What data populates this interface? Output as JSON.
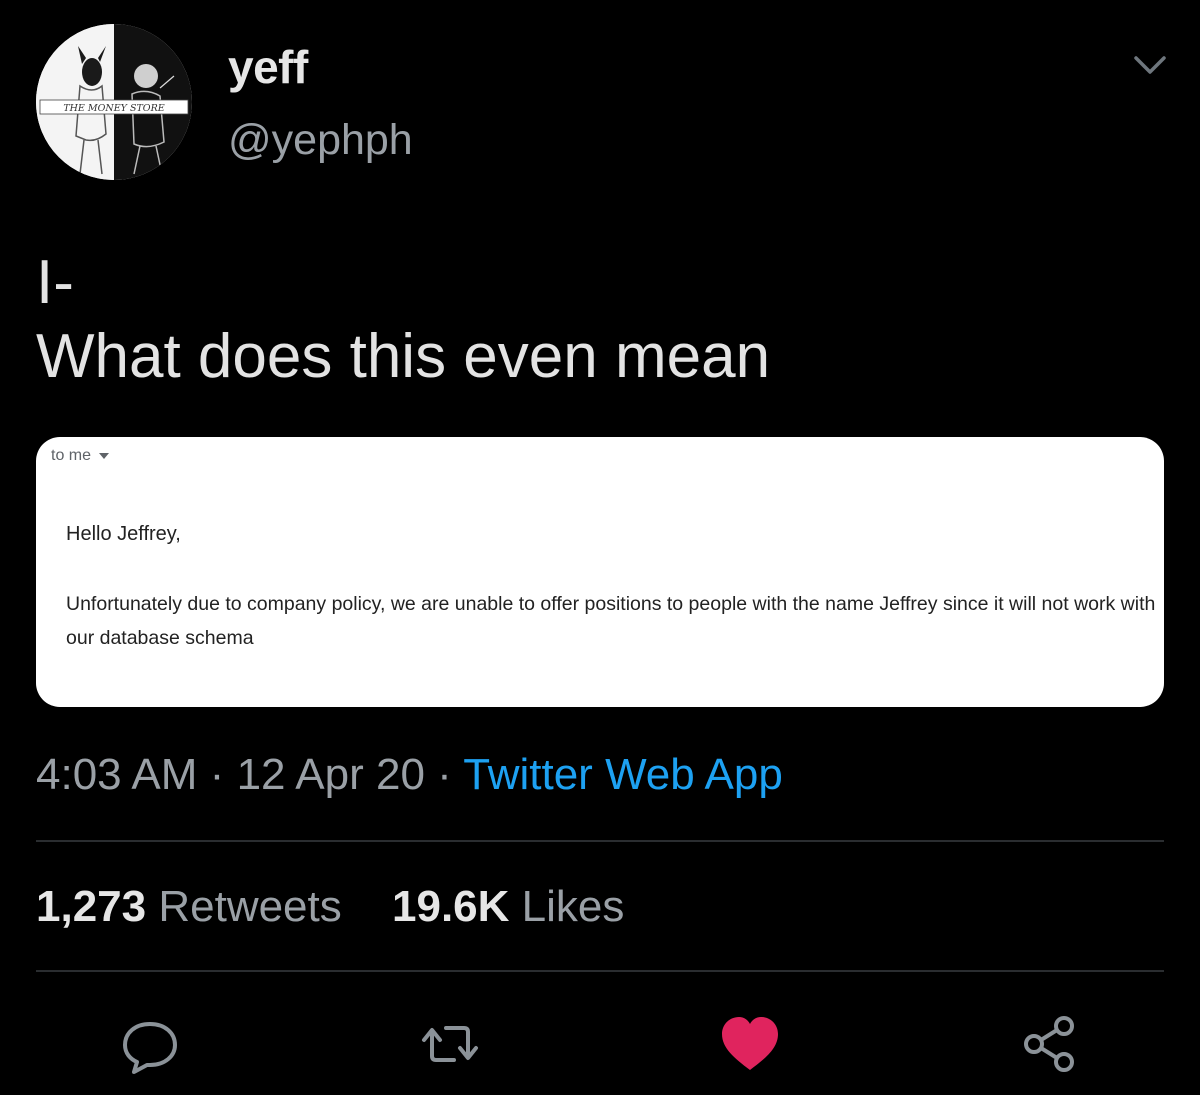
{
  "tweet": {
    "user": {
      "display_name": "yeff",
      "handle": "@yephph",
      "avatar_text": "THE MONEY STORE"
    },
    "text": "I-\nWhat does this even mean",
    "email": {
      "to": "to me",
      "greeting": "Hello Jeffrey,",
      "body": "Unfortunately due to company policy, we are unable to offer positions to people with the name Jeffrey since it will not work with our database schema"
    },
    "timestamp": "4:03 AM",
    "date": "12 Apr 20",
    "source": "Twitter Web App",
    "retweets": {
      "count": "1,273",
      "label": "Retweets"
    },
    "likes": {
      "count": "19.6K",
      "label": "Likes"
    },
    "actions": [
      {
        "icon": "reply-icon"
      },
      {
        "icon": "retweet-icon"
      },
      {
        "icon": "like-icon",
        "active": true,
        "color": "#e0245e"
      },
      {
        "icon": "share-icon"
      }
    ]
  },
  "colors": {
    "background": "#000000",
    "link": "#1da1f2",
    "like": "#e0245e",
    "secondary_text": "#9aa0a6"
  }
}
